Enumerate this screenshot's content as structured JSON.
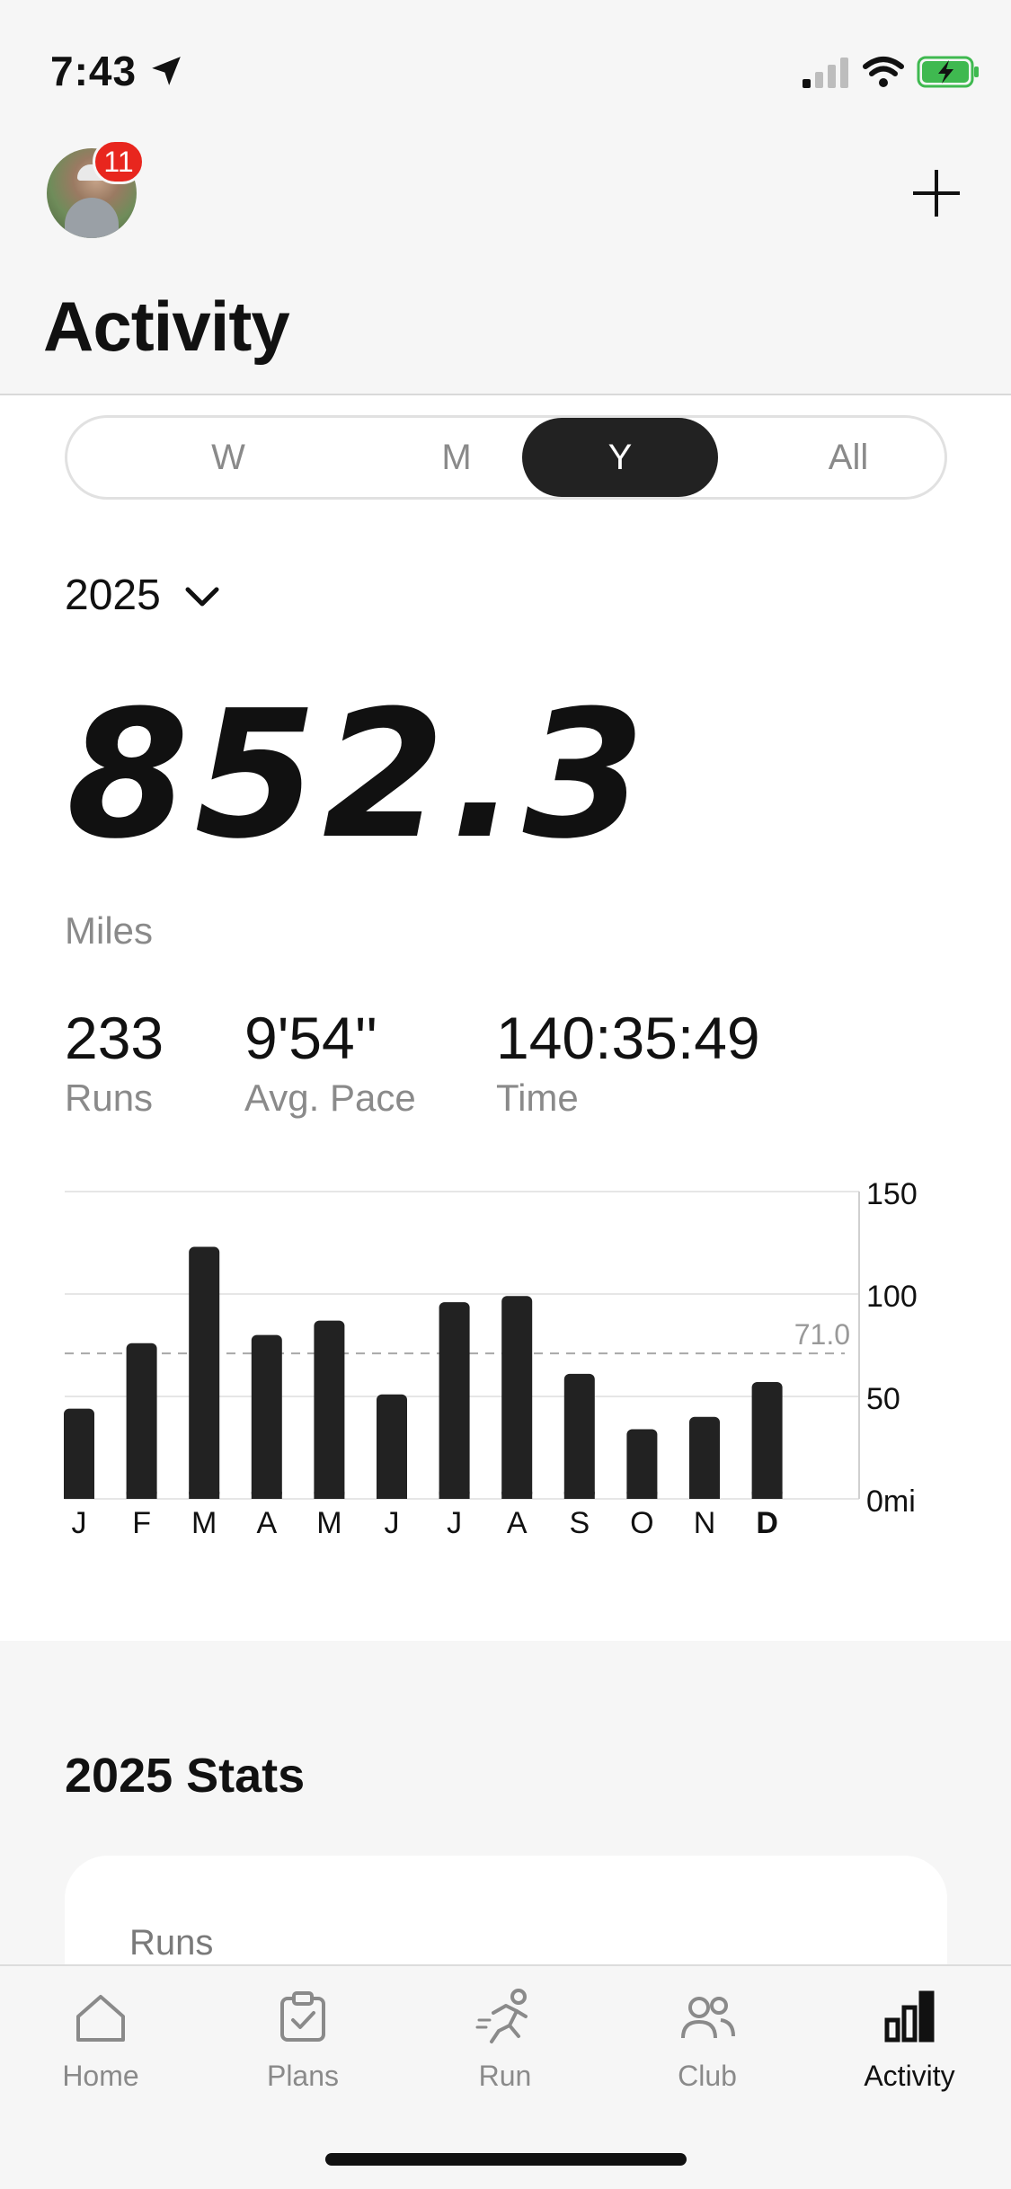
{
  "status_bar": {
    "time": "7:43"
  },
  "header": {
    "notification_count": "11",
    "title": "Activity"
  },
  "period_tabs": {
    "items": [
      "W",
      "M",
      "Y",
      "All"
    ],
    "selected": "Y"
  },
  "year_selector": {
    "value": "2025"
  },
  "summary": {
    "distance": "852.3",
    "distance_unit": "Miles",
    "stats": [
      {
        "value": "233",
        "label": "Runs"
      },
      {
        "value": "9'54''",
        "label": "Avg. Pace"
      },
      {
        "value": "140:35:49",
        "label": "Time"
      }
    ]
  },
  "chart_data": {
    "type": "bar",
    "categories": [
      "J",
      "F",
      "M",
      "A",
      "M",
      "J",
      "J",
      "A",
      "S",
      "O",
      "N",
      "D"
    ],
    "values": [
      44,
      76,
      123,
      80,
      87,
      51,
      96,
      99,
      61,
      34,
      40,
      57
    ],
    "yticks": [
      "150",
      "100",
      "50",
      "0mi"
    ],
    "ylim": [
      0,
      150
    ],
    "average": 71.0,
    "average_label": "71.0",
    "highlight_category_index": 11,
    "grid": true,
    "bar_color": "#222222"
  },
  "stats_section": {
    "title": "2025 Stats",
    "card_label": "Runs"
  },
  "tabbar": {
    "items": [
      {
        "label": "Home",
        "icon": "home-icon"
      },
      {
        "label": "Plans",
        "icon": "clipboard-check-icon"
      },
      {
        "label": "Run",
        "icon": "runner-icon"
      },
      {
        "label": "Club",
        "icon": "people-icon"
      },
      {
        "label": "Activity",
        "icon": "bar-chart-icon"
      }
    ],
    "active": "Activity"
  }
}
